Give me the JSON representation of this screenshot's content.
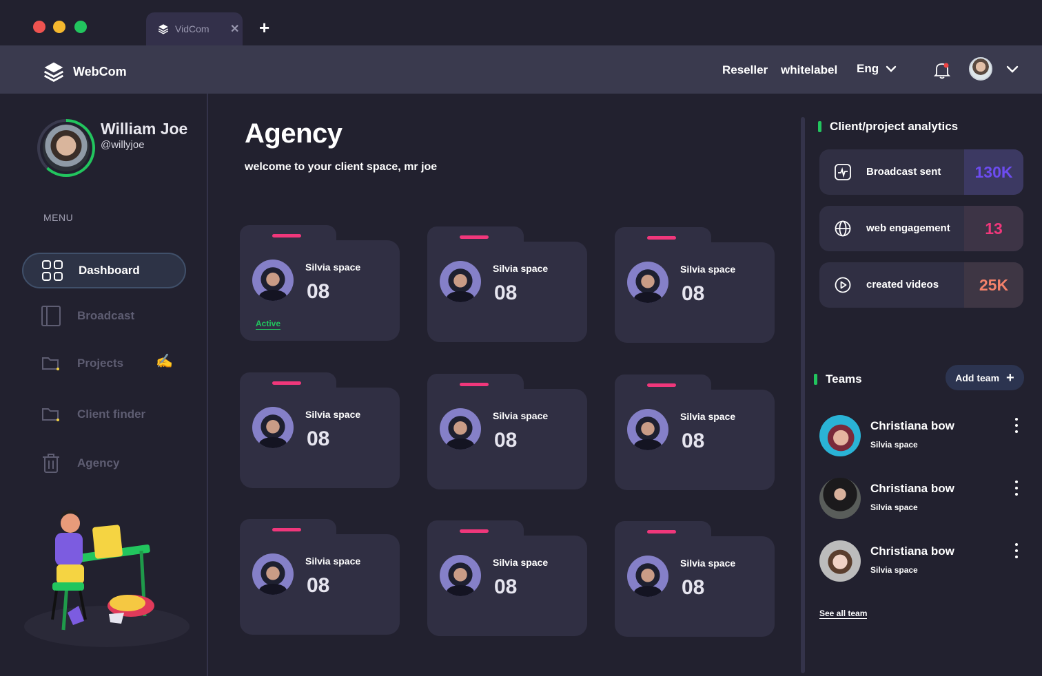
{
  "browser": {
    "tab_label": "VidCom",
    "tab_close": "✕",
    "new_tab": "+"
  },
  "header": {
    "brand": "WebCom",
    "links": [
      "Reseller",
      "whitelabel"
    ],
    "language": "Eng",
    "icons": [
      "layers-logo-icon",
      "bell-icon",
      "chevron-down-icon"
    ]
  },
  "profile": {
    "name": "William Joe",
    "handle": "@willyjoe"
  },
  "sidebar": {
    "menu_title": "MENU",
    "items": [
      {
        "label": "Dashboard",
        "icon": "grid-icon",
        "active": true
      },
      {
        "label": "Broadcast",
        "icon": "book-icon",
        "active": false
      },
      {
        "label": "Projects",
        "icon": "folder-icon",
        "active": false
      },
      {
        "label": "Client finder",
        "icon": "folder-icon",
        "active": false
      },
      {
        "label": "Agency",
        "icon": "trash-icon",
        "active": false
      }
    ]
  },
  "main": {
    "title": "Agency",
    "subtitle": "welcome to your client space, mr joe",
    "cards": [
      {
        "name": "Silvia space",
        "count": "08",
        "status": "Active"
      },
      {
        "name": "Silvia space",
        "count": "08",
        "status": ""
      },
      {
        "name": "Silvia space",
        "count": "08",
        "status": ""
      },
      {
        "name": "Silvia space",
        "count": "08",
        "status": ""
      },
      {
        "name": "Silvia space",
        "count": "08",
        "status": ""
      },
      {
        "name": "Silvia space",
        "count": "08",
        "status": ""
      },
      {
        "name": "Silvia space",
        "count": "08",
        "status": ""
      },
      {
        "name": "Silvia space",
        "count": "08",
        "status": ""
      },
      {
        "name": "Silvia space",
        "count": "08",
        "status": ""
      }
    ]
  },
  "analytics": {
    "title": "Client/project analytics",
    "stats": [
      {
        "label": "Broadcast sent",
        "value": "130K",
        "icon": "activity-icon",
        "color": "#6d4cf0"
      },
      {
        "label": "web engagement",
        "value": "13",
        "icon": "globe-icon",
        "color": "#f0377b"
      },
      {
        "label": "created videos",
        "value": "25K",
        "icon": "play-icon",
        "color": "#f4816a"
      }
    ]
  },
  "teams": {
    "title": "Teams",
    "add_label": "Add team",
    "members": [
      {
        "name": "Christiana bow",
        "sub": "Silvia space"
      },
      {
        "name": "Christiana bow",
        "sub": "Silvia space"
      },
      {
        "name": "Christiana bow",
        "sub": "Silvia space"
      }
    ],
    "see_all": "See all team"
  },
  "colors": {
    "accent_green": "#22c55e",
    "accent_pink": "#f0377b",
    "accent_purple": "#6d4cf0",
    "background": "#22212f"
  }
}
